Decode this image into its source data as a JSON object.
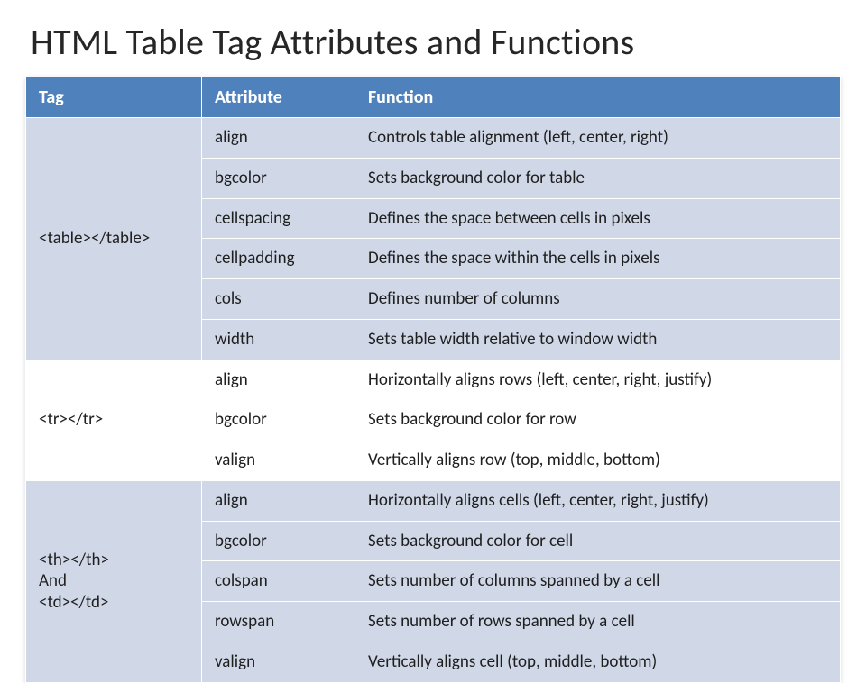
{
  "title": "HTML Table Tag Attributes and Functions",
  "columns": {
    "tag": "Tag",
    "attribute": "Attribute",
    "function": "Function"
  },
  "groups": [
    {
      "tag_label": "<table></table>",
      "rows": [
        {
          "attr": "align",
          "fn": "Controls table alignment (left, center, right)"
        },
        {
          "attr": "bgcolor",
          "fn": "Sets background color for table"
        },
        {
          "attr": "cellspacing",
          "fn": "Defines the space between cells in pixels"
        },
        {
          "attr": "cellpadding",
          "fn": "Defines the space within the cells in pixels"
        },
        {
          "attr": "cols",
          "fn": "Defines number of columns"
        },
        {
          "attr": "width",
          "fn": "Sets table width relative to window width"
        }
      ]
    },
    {
      "tag_label": "<tr></tr>",
      "rows": [
        {
          "attr": "align",
          "fn": "Horizontally aligns rows (left, center, right, justify)"
        },
        {
          "attr": "bgcolor",
          "fn": "Sets background color for row"
        },
        {
          "attr": "valign",
          "fn": "Vertically aligns row (top, middle, bottom)"
        }
      ]
    },
    {
      "tag_label": "<th></th>\nAnd\n<td></td>",
      "rows": [
        {
          "attr": "align",
          "fn": "Horizontally aligns cells (left, center, right,  justify)"
        },
        {
          "attr": "bgcolor",
          "fn": "Sets background color for cell"
        },
        {
          "attr": "colspan",
          "fn": "Sets number of columns spanned by a cell"
        },
        {
          "attr": "rowspan",
          "fn": "Sets number of rows spanned by a cell"
        },
        {
          "attr": "valign",
          "fn": "Vertically aligns cell (top, middle, bottom)"
        }
      ]
    }
  ]
}
